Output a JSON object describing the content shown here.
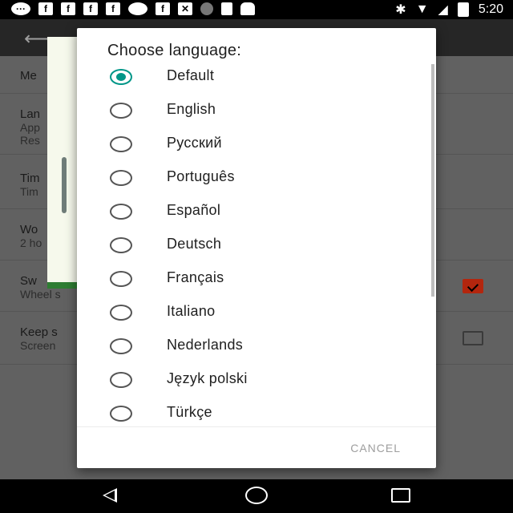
{
  "status_bar": {
    "time": "5:20",
    "left_icons": [
      "chat-icon",
      "f-icon",
      "f-icon",
      "f-icon",
      "f-icon",
      "cloud-icon",
      "f-icon",
      "satellite-icon",
      "alert-icon",
      "lock-icon",
      "android-icon"
    ],
    "right_icons": [
      "bluetooth-icon",
      "wifi-icon",
      "signal-icon",
      "battery-icon"
    ]
  },
  "background_app": {
    "settings": [
      {
        "title": "Me",
        "subtitle": ""
      },
      {
        "title": "Lan",
        "subtitle": "App",
        "subtitle2": "Res"
      },
      {
        "title": "Tim",
        "subtitle": "Tim"
      },
      {
        "title": "Wo",
        "subtitle": "2 ho"
      },
      {
        "title": "Sw",
        "subtitle": "Wheel s",
        "checked": true
      },
      {
        "title": "Keep s",
        "subtitle": "Screen",
        "checked": false
      }
    ]
  },
  "dialog": {
    "title": "Choose language:",
    "selected": "Default",
    "options": [
      "Default",
      "English",
      "Русский",
      "Português",
      "Español",
      "Deutsch",
      "Français",
      "Italiano",
      "Nederlands",
      "Język polski",
      "Türkçe"
    ],
    "cancel_label": "CANCEL",
    "accent_color": "#009688"
  },
  "colors": {
    "checkbox_checked": "#b3260e",
    "scrim": "#616161"
  }
}
